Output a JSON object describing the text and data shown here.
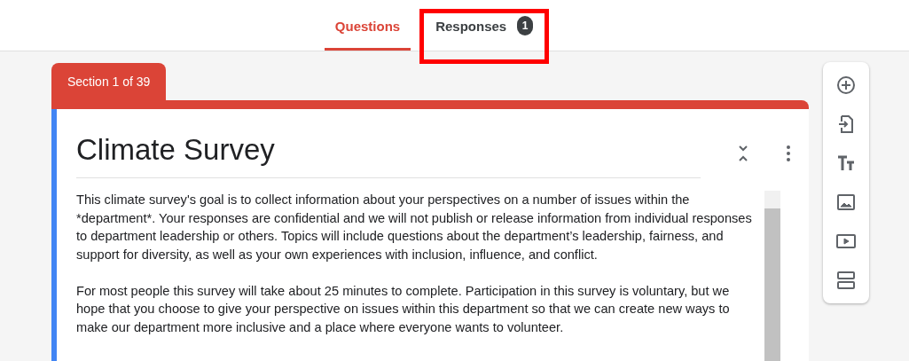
{
  "tabs": [
    {
      "label": "Questions",
      "selected": true
    },
    {
      "label": "Responses",
      "selected": false,
      "badge": "1",
      "highlighted": true
    }
  ],
  "section_tab": {
    "label": "Section 1 of 39"
  },
  "form": {
    "title": "Climate Survey",
    "description": [
      "This climate survey's goal is to collect information about your perspectives on a number of issues within the *department*. Your responses are confidential and we will not publish or release information from individual responses to department leadership or others. Topics will include questions about the department’s leadership, fairness, and support for diversity, as well as your own experiences with inclusion, influence, and conflict.",
      "For most people this survey will take about 25 minutes to complete. Participation in this survey is voluntary, but we hope that you choose to give your perspective on issues within this department so that we can create new ways to make our department more inclusive and a place where everyone wants to volunteer."
    ]
  },
  "toolbar": [
    {
      "kind": "add"
    },
    {
      "kind": "import"
    },
    {
      "kind": "title"
    },
    {
      "kind": "image"
    },
    {
      "kind": "video"
    },
    {
      "kind": "section"
    }
  ]
}
